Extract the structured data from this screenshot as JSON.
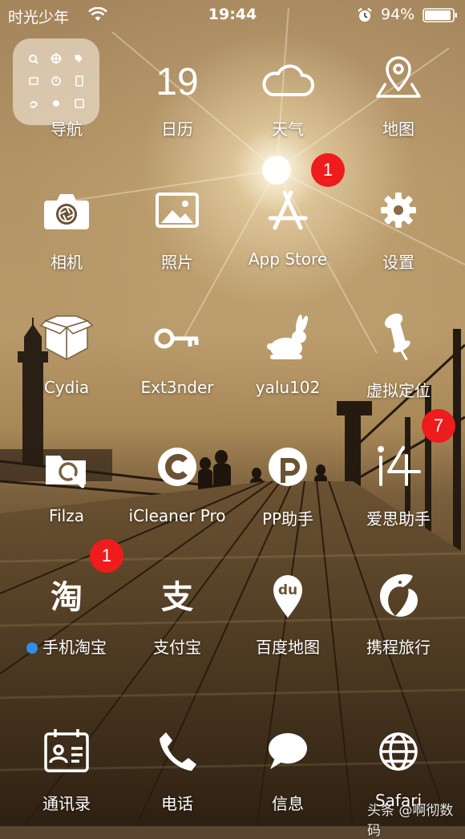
{
  "status_bar": {
    "carrier": "时光少年",
    "time": "19:44",
    "battery_percent": "94%",
    "battery_level": 0.94
  },
  "apps": [
    {
      "label": "导航",
      "icon": "folder-icon"
    },
    {
      "label": "日历",
      "icon": "calendar-icon",
      "icon_text": "19"
    },
    {
      "label": "天气",
      "icon": "weather-cloud-icon"
    },
    {
      "label": "地图",
      "icon": "map-icon"
    },
    {
      "label": "相机",
      "icon": "camera-icon"
    },
    {
      "label": "照片",
      "icon": "photos-icon"
    },
    {
      "label": "App Store",
      "icon": "app-store-icon",
      "badge": "1"
    },
    {
      "label": "设置",
      "icon": "gear-icon"
    },
    {
      "label": "Cydia",
      "icon": "cydia-box-icon"
    },
    {
      "label": "Ext3nder",
      "icon": "key-icon"
    },
    {
      "label": "yalu102",
      "icon": "rabbit-icon"
    },
    {
      "label": "虚拟定位",
      "icon": "pushpin-icon"
    },
    {
      "label": "Filza",
      "icon": "folder-search-icon"
    },
    {
      "label": "iCleaner Pro",
      "icon": "icleaner-icon"
    },
    {
      "label": "PP助手",
      "icon": "pp-icon"
    },
    {
      "label": "爱思助手",
      "icon": "i4-icon",
      "icon_text": "i4",
      "badge": "7"
    },
    {
      "label": "手机淘宝",
      "icon": "taobao-icon",
      "icon_text": "淘",
      "badge": "1"
    },
    {
      "label": "支付宝",
      "icon": "alipay-icon",
      "icon_text": "支"
    },
    {
      "label": "百度地图",
      "icon": "baidu-map-icon",
      "icon_text": "du"
    },
    {
      "label": "携程旅行",
      "icon": "dolphin-icon"
    }
  ],
  "dock": [
    {
      "label": "通讯录",
      "icon": "contacts-icon"
    },
    {
      "label": "电话",
      "icon": "phone-icon"
    },
    {
      "label": "信息",
      "icon": "message-bubble-icon"
    },
    {
      "label": "Safari",
      "icon": "globe-icon"
    }
  ],
  "watermark": "头条 @啊彻数码",
  "colors": {
    "badge": "#ee1c1c",
    "folder": "#e8dac6",
    "new_dot": "#2f8fe8"
  }
}
